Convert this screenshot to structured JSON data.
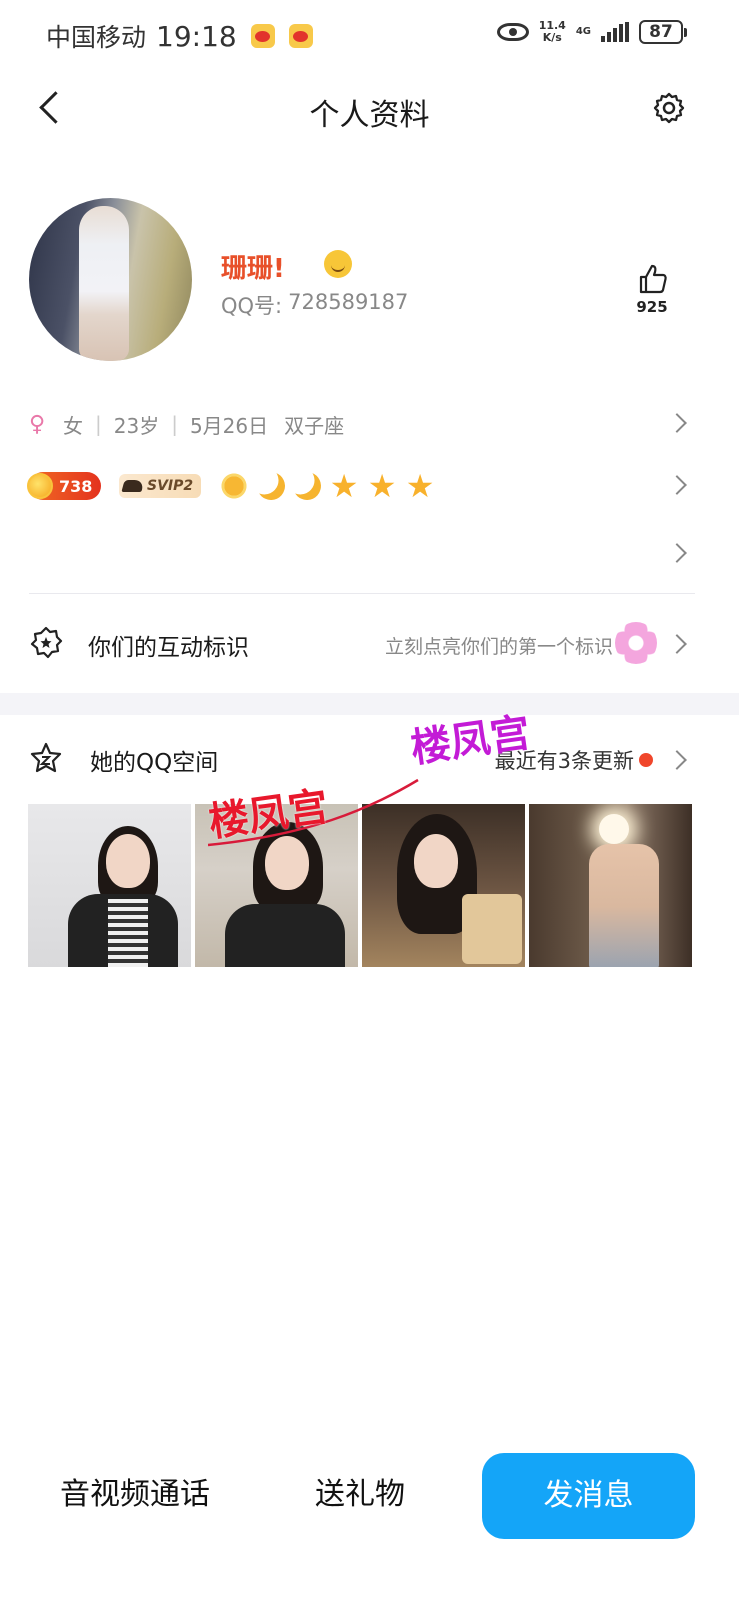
{
  "status_bar": {
    "carrier": "中国移动",
    "time": "19:18",
    "net_speed_value": "11.4",
    "net_speed_unit": "K/s",
    "network_type": "4G",
    "battery": "87"
  },
  "header": {
    "title": "个人资料"
  },
  "profile": {
    "nickname": "珊珊!",
    "qq_label": "QQ号:",
    "qq_number": "728589187",
    "like_count": "925"
  },
  "basic_info": {
    "gender_symbol": "♀",
    "gender": "女",
    "age": "23岁",
    "birthday": "5月26日",
    "zodiac": "双子座"
  },
  "badges": {
    "level_number": "738",
    "vip_label": "SVIP2",
    "level_icons": [
      "sun-icon",
      "moon-icon",
      "moon-icon",
      "star-icon",
      "star-icon",
      "star-icon"
    ]
  },
  "interaction": {
    "label": "你们的互动标识",
    "hint": "立刻点亮你们的第一个标识"
  },
  "qzone": {
    "label": "她的QQ空间",
    "update_text": "最近有3条更新"
  },
  "watermarks": [
    "楼凤宫",
    "楼凤宫"
  ],
  "actions": {
    "call": "音视频通话",
    "gift": "送礼物",
    "message": "发消息"
  },
  "colors": {
    "nickname": "#e8502a",
    "primary_button": "#14a5f8",
    "red_dot": "#f0462b",
    "watermark_red": "#e8182c",
    "watermark_purple": "#c31bd6"
  }
}
